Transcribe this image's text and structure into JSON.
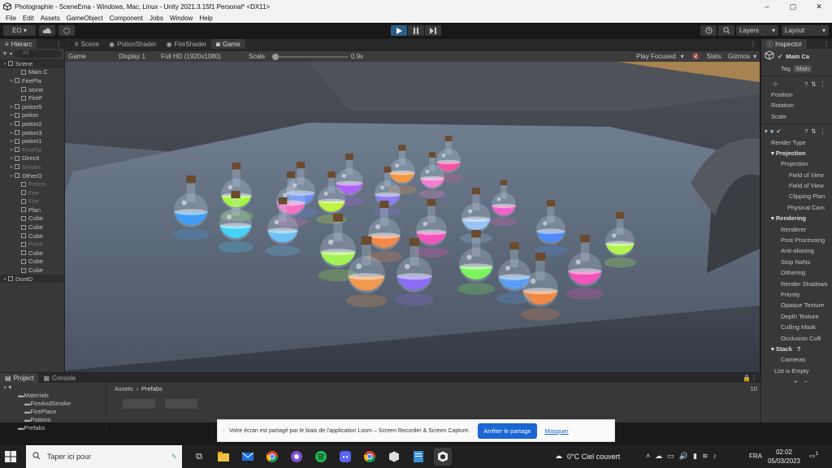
{
  "window": {
    "title": "Photographie - SceneEma - Windows, Mac, Linux - Unity 2021.3.15f1 Personal* <DX11>",
    "controls": [
      "–",
      "▢",
      "✕"
    ]
  },
  "menu": [
    "File",
    "Edit",
    "Assets",
    "GameObject",
    "Component",
    "Jobs",
    "Window",
    "Help"
  ],
  "toolbar": {
    "account": "EO ▾",
    "layers": "Layers",
    "layout": "Layout"
  },
  "hierarchy": {
    "tab": "Hierarc",
    "search_placeholder": "All",
    "rows": [
      {
        "label": "Scene",
        "indent": 0,
        "type": "scene"
      },
      {
        "label": "Main C",
        "indent": 2,
        "type": "obj"
      },
      {
        "label": "FirePla",
        "indent": 1,
        "type": "obj"
      },
      {
        "label": "stone",
        "indent": 2,
        "type": "obj"
      },
      {
        "label": "FireF",
        "indent": 2,
        "type": "obj"
      },
      {
        "label": "potion5",
        "indent": 1,
        "type": "obj"
      },
      {
        "label": "potion",
        "indent": 1,
        "type": "obj"
      },
      {
        "label": "potion2",
        "indent": 1,
        "type": "obj"
      },
      {
        "label": "potion3",
        "indent": 1,
        "type": "obj"
      },
      {
        "label": "potion1",
        "indent": 1,
        "type": "obj"
      },
      {
        "label": "FirePla",
        "indent": 1,
        "type": "dim"
      },
      {
        "label": "Directi",
        "indent": 1,
        "type": "obj"
      },
      {
        "label": "Smoke",
        "indent": 1,
        "type": "dim"
      },
      {
        "label": "OtherO",
        "indent": 1,
        "type": "obj"
      },
      {
        "label": "Potion",
        "indent": 2,
        "type": "dim"
      },
      {
        "label": "Fire",
        "indent": 2,
        "type": "dim"
      },
      {
        "label": "Fire",
        "indent": 2,
        "type": "dim"
      },
      {
        "label": "Plan",
        "indent": 2,
        "type": "obj"
      },
      {
        "label": "Cube",
        "indent": 2,
        "type": "obj"
      },
      {
        "label": "Cube",
        "indent": 2,
        "type": "obj"
      },
      {
        "label": "Cube",
        "indent": 2,
        "type": "obj"
      },
      {
        "label": "Point",
        "indent": 2,
        "type": "dim"
      },
      {
        "label": "Cube",
        "indent": 2,
        "type": "obj"
      },
      {
        "label": "Cube",
        "indent": 2,
        "type": "obj"
      },
      {
        "label": "Cube",
        "indent": 2,
        "type": "obj"
      },
      {
        "label": "DontD",
        "indent": 0,
        "type": "scene"
      }
    ]
  },
  "tabs": [
    {
      "label": "Scene",
      "selected": false
    },
    {
      "label": "PotionShader",
      "selected": false
    },
    {
      "label": "FireShader",
      "selected": false
    },
    {
      "label": "Game",
      "selected": true
    }
  ],
  "game_toolbar": {
    "mode": "Game",
    "display": "Display 1",
    "resolution": "Full HD (1920x1080)",
    "scale_label": "Scale",
    "scale_value": "0.9x",
    "play_focused": "Play Focused",
    "stats": "Stats",
    "gizmos": "Gizmos"
  },
  "inspector": {
    "tab": "Inspector",
    "object_name": "Main Ca",
    "tag_label": "Tag",
    "tag_value": "Main",
    "transform": [
      "Position",
      "Rotation",
      "Scale"
    ],
    "camera": {
      "render_type": "Render Type",
      "projection_header": "Projection",
      "projection_items": [
        "Projection",
        "Field of View",
        "Field of View",
        "Clipping Plan"
      ],
      "physical": "Physical Cam",
      "rendering_header": "Rendering",
      "rendering_items": [
        "Renderer",
        "Post Processing",
        "Anti-aliasing",
        "Stop NaNs",
        "Dithering",
        "Render Shadows",
        "Priority",
        "Opaque Texture",
        "Depth Texture",
        "Culling Mask",
        "Occlusion Culli"
      ],
      "stack_header": "Stack",
      "stack_items": [
        "Cameras",
        "List is Empty"
      ]
    }
  },
  "project": {
    "tabs": [
      "Project",
      "Console"
    ],
    "folders": [
      "Materials",
      "FireAndSmoke",
      "FirePlace",
      "Potions",
      "Prefabs"
    ],
    "breadcrumb": [
      "Assets",
      "Prefabs"
    ],
    "hidden_count": "10"
  },
  "sharebar": {
    "message": "Votre écran est partagé par le biais de l'application Loom – Screen Recorder & Screen Capture.",
    "stop": "Arrêter le partage",
    "hide": "Masquer"
  },
  "taskbar": {
    "search_placeholder": "Taper ici pour",
    "weather": "0°C  Ciel couvert",
    "lang": "FRA",
    "time": "02:02",
    "date": "05/03/2023",
    "notifications": "1"
  },
  "potions": [
    {
      "color": "#3aa0ff"
    },
    {
      "color": "#a8ff3a"
    },
    {
      "color": "#6a8cff"
    },
    {
      "color": "#b65cff"
    },
    {
      "color": "#ff9a3a"
    },
    {
      "color": "#ff4fa3"
    },
    {
      "color": "#44d6ff"
    },
    {
      "color": "#ff6fc7"
    },
    {
      "color": "#c8ff3a"
    },
    {
      "color": "#8c7bff"
    },
    {
      "color": "#ff7ed6"
    },
    {
      "color": "#ff5bd0"
    },
    {
      "color": "#6cc9ff"
    },
    {
      "color": "#a8ff4a"
    },
    {
      "color": "#ff8844"
    },
    {
      "color": "#ff4fbf"
    },
    {
      "color": "#9acbff"
    },
    {
      "color": "#4d8cff"
    },
    {
      "color": "#ff9a4a"
    },
    {
      "color": "#8f6cff"
    },
    {
      "color": "#7cff5a"
    },
    {
      "color": "#ff8a3a"
    },
    {
      "color": "#ff4fbf"
    },
    {
      "color": "#b9ff4a"
    },
    {
      "color": "#5aa0ff"
    }
  ]
}
